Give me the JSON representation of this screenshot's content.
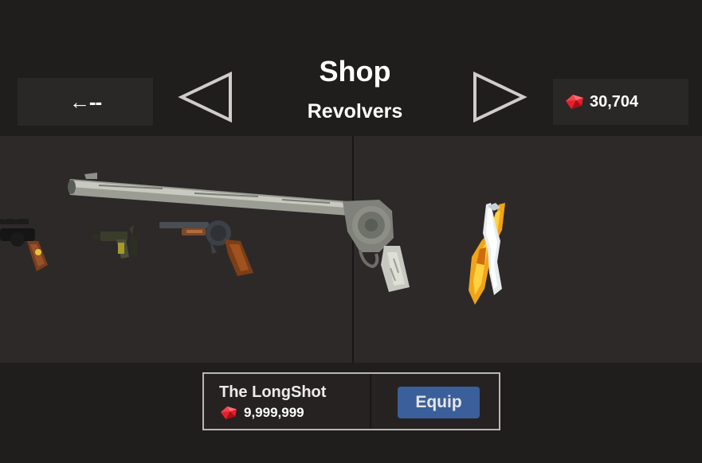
{
  "header": {
    "back_label": "←--",
    "title": "Shop",
    "category": "Revolvers",
    "currency_amount": "30,704"
  },
  "currency": {
    "icon": "ruby-gem-icon",
    "color": "#e5202c"
  },
  "showcase": {
    "items": [
      {
        "name": "scoped-revolver",
        "visible": "partial"
      },
      {
        "name": "small-olive-pistol"
      },
      {
        "name": "wooden-grip-revolver"
      },
      {
        "name": "the-longshot",
        "selected": true
      },
      {
        "name": "flame-and-ice-pistols"
      }
    ]
  },
  "selected_item": {
    "name": "The LongShot",
    "price": "9,999,999",
    "action_label": "Equip"
  },
  "colors": {
    "background": "#201d1d",
    "panel": "#2a2727",
    "showcase": "#2d2929",
    "equip_button": "#3b5f9a"
  }
}
